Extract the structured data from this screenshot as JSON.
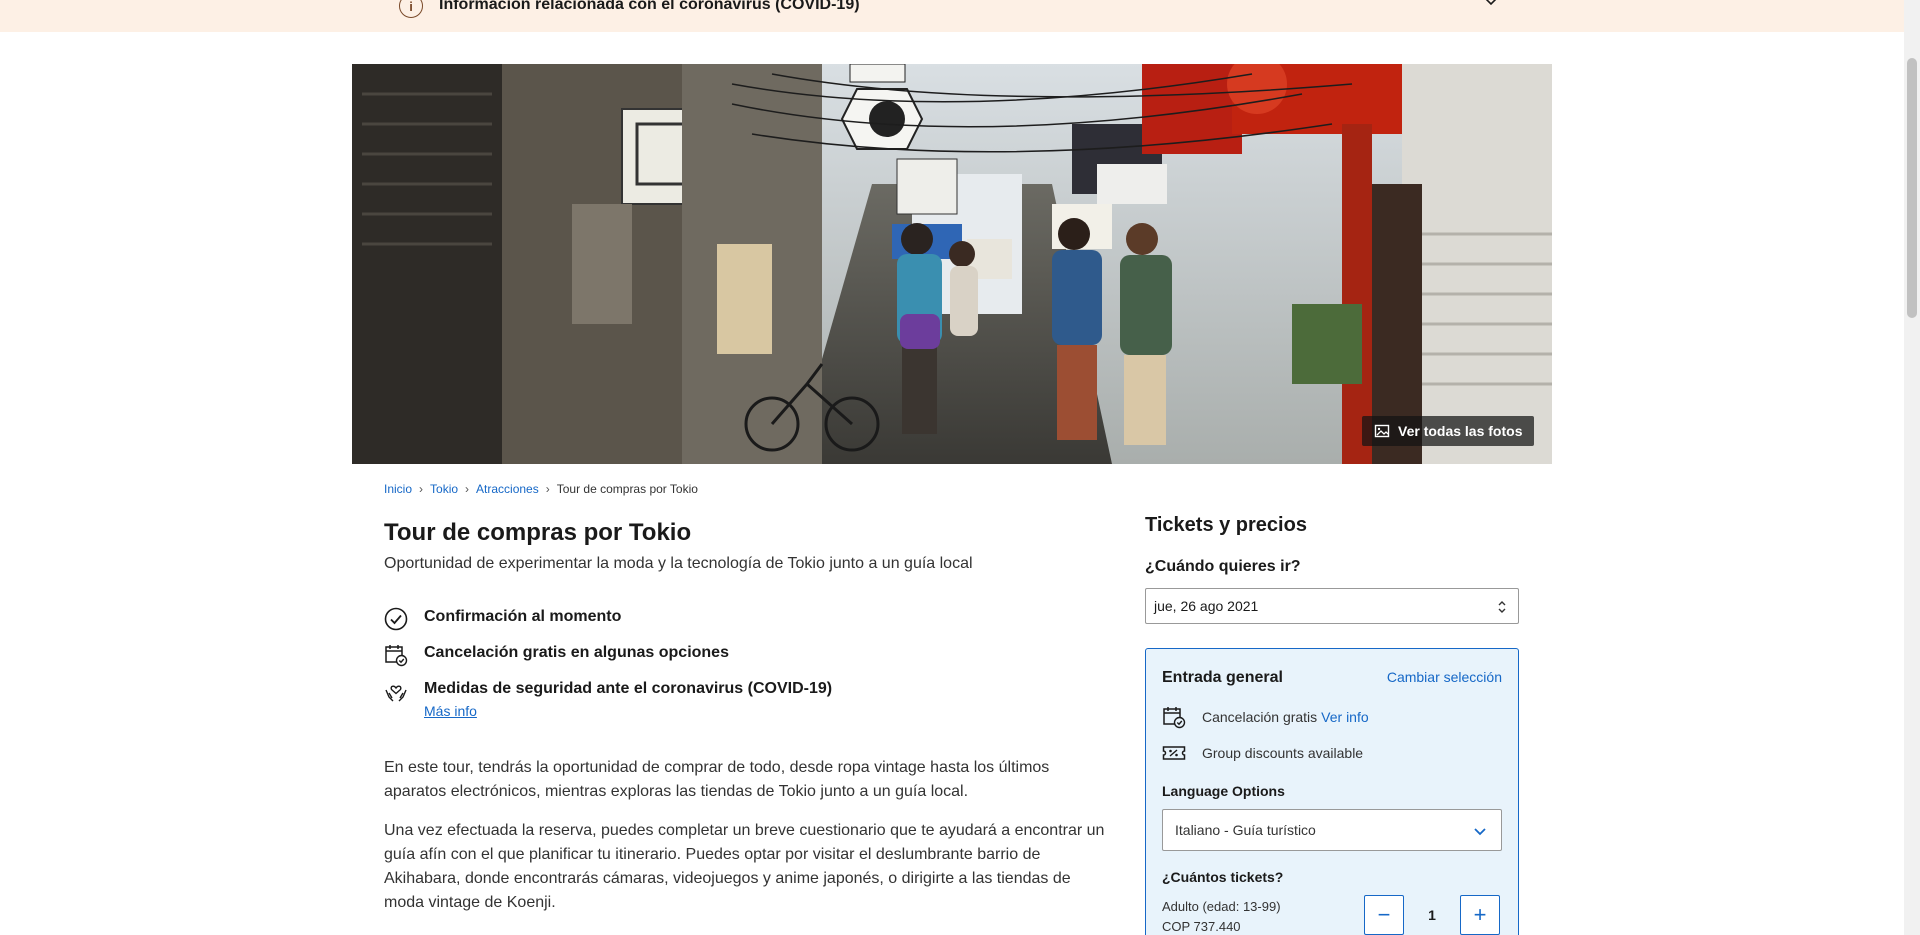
{
  "covid_banner": {
    "text": "Información relacionada con el coronavirus (COVID-19)",
    "info_glyph": "i"
  },
  "hero": {
    "photos_button": "Ver todas las fotos"
  },
  "breadcrumb": {
    "items": [
      "Inicio",
      "Tokio",
      "Atracciones"
    ],
    "current": "Tour de compras por Tokio",
    "separator": "›"
  },
  "product": {
    "title": "Tour de compras por Tokio",
    "subtitle": "Oportunidad de experimentar la moda y la tecnología de Tokio junto a un guía local",
    "features": [
      {
        "icon": "check-circle-icon",
        "text": "Confirmación al momento"
      },
      {
        "icon": "calendar-check-icon",
        "text": "Cancelación gratis en algunas opciones"
      },
      {
        "icon": "safety-hands-icon",
        "text": "Medidas de seguridad ante el coronavirus (COVID-19)",
        "link": "Más info"
      }
    ],
    "description": [
      "En este tour, tendrás la oportunidad de comprar de todo, desde ropa vintage hasta los últimos aparatos electrónicos, mientras exploras las tiendas de Tokio junto a un guía local.",
      "Una vez efectuada la reserva, puedes completar un breve cuestionario que te ayudará a encontrar un guía afín con el que planificar tu itinerario. Puedes optar por visitar el deslumbrante barrio de Akihabara, donde encontrarás cámaras, videojuegos y anime japonés, o dirigirte a las tiendas de moda vintage de Koenji."
    ]
  },
  "tickets": {
    "title": "Tickets y precios",
    "when_label": "¿Cuándo quieres ir?",
    "date_value": "jue, 26 ago 2021",
    "option": {
      "title": "Entrada general",
      "change_link": "Cambiar selección",
      "cancel_text": "Cancelación gratis",
      "cancel_link": "Ver info",
      "group_text": "Group discounts available",
      "language_label": "Language Options",
      "language_value": "Italiano - Guía turístico",
      "quantity_label": "¿Cuántos tickets?",
      "ticket_type": "Adulto (edad: 13-99)",
      "ticket_price": "COP 737.440",
      "quantity": "1",
      "minus": "−",
      "plus": "+"
    }
  },
  "colors": {
    "banner_bg": "#fdf0e5",
    "link_blue": "#1668c7",
    "card_bg": "#e8f3fb",
    "card_border": "#1668c7"
  }
}
